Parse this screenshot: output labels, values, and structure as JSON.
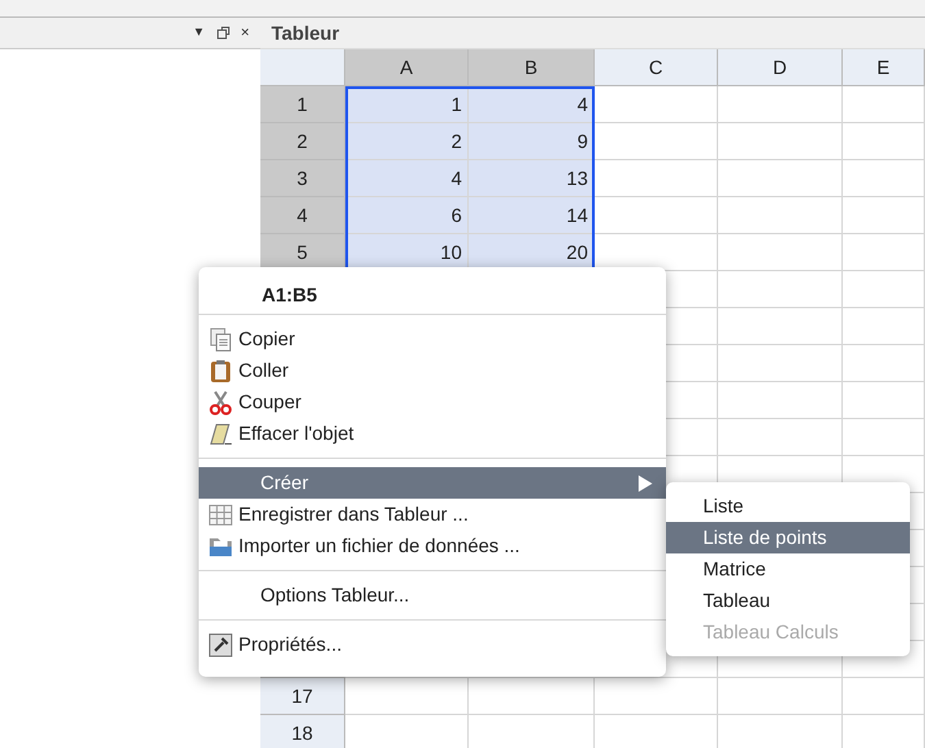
{
  "left_panel": {
    "controls": [
      "▼",
      "×"
    ]
  },
  "spreadsheet": {
    "title": "Tableur",
    "columns": [
      {
        "label": "A",
        "selected": true
      },
      {
        "label": "B",
        "selected": true
      },
      {
        "label": "C",
        "selected": false
      },
      {
        "label": "D",
        "selected": false
      },
      {
        "label": "E",
        "selected": false
      }
    ],
    "rows": [
      {
        "header": "1",
        "selected": true,
        "cells": [
          "1",
          "4"
        ]
      },
      {
        "header": "2",
        "selected": true,
        "cells": [
          "2",
          "9"
        ]
      },
      {
        "header": "3",
        "selected": true,
        "cells": [
          "4",
          "13"
        ]
      },
      {
        "header": "4",
        "selected": true,
        "cells": [
          "6",
          "14"
        ]
      },
      {
        "header": "5",
        "selected": true,
        "cells": [
          "10",
          "20"
        ]
      }
    ],
    "bottom_rows": [
      {
        "header": "17",
        "selected": false
      },
      {
        "header": "18",
        "selected": false
      }
    ]
  },
  "context_menu": {
    "title": "A1:B5",
    "groups": [
      [
        {
          "label": "Copier",
          "kind": "copy",
          "selected": false,
          "submenu": false
        },
        {
          "label": "Coller",
          "kind": "paste",
          "selected": false,
          "submenu": false
        },
        {
          "label": "Couper",
          "kind": "cut",
          "selected": false,
          "submenu": false
        },
        {
          "label": "Effacer l'objet",
          "kind": "erase",
          "selected": false,
          "submenu": false
        }
      ],
      [
        {
          "label": "Créer",
          "kind": "plain",
          "selected": true,
          "submenu": true
        },
        {
          "label": "Enregistrer dans Tableur ...",
          "kind": "grid",
          "selected": false,
          "submenu": false
        },
        {
          "label": "Importer un fichier de données ...",
          "kind": "folder",
          "selected": false,
          "submenu": false
        }
      ],
      [
        {
          "label": "Options Tableur...",
          "kind": "plain",
          "selected": false,
          "submenu": false
        }
      ],
      [
        {
          "label": "Propriétés...",
          "kind": "wrench",
          "selected": false,
          "submenu": false
        }
      ]
    ]
  },
  "submenu": {
    "items": [
      {
        "label": "Liste",
        "selected": false,
        "disabled": false
      },
      {
        "label": "Liste de points",
        "selected": true,
        "disabled": false
      },
      {
        "label": "Matrice",
        "selected": false,
        "disabled": false
      },
      {
        "label": "Tableau",
        "selected": false,
        "disabled": false
      },
      {
        "label": "Tableau Calculs",
        "selected": false,
        "disabled": true
      }
    ]
  }
}
